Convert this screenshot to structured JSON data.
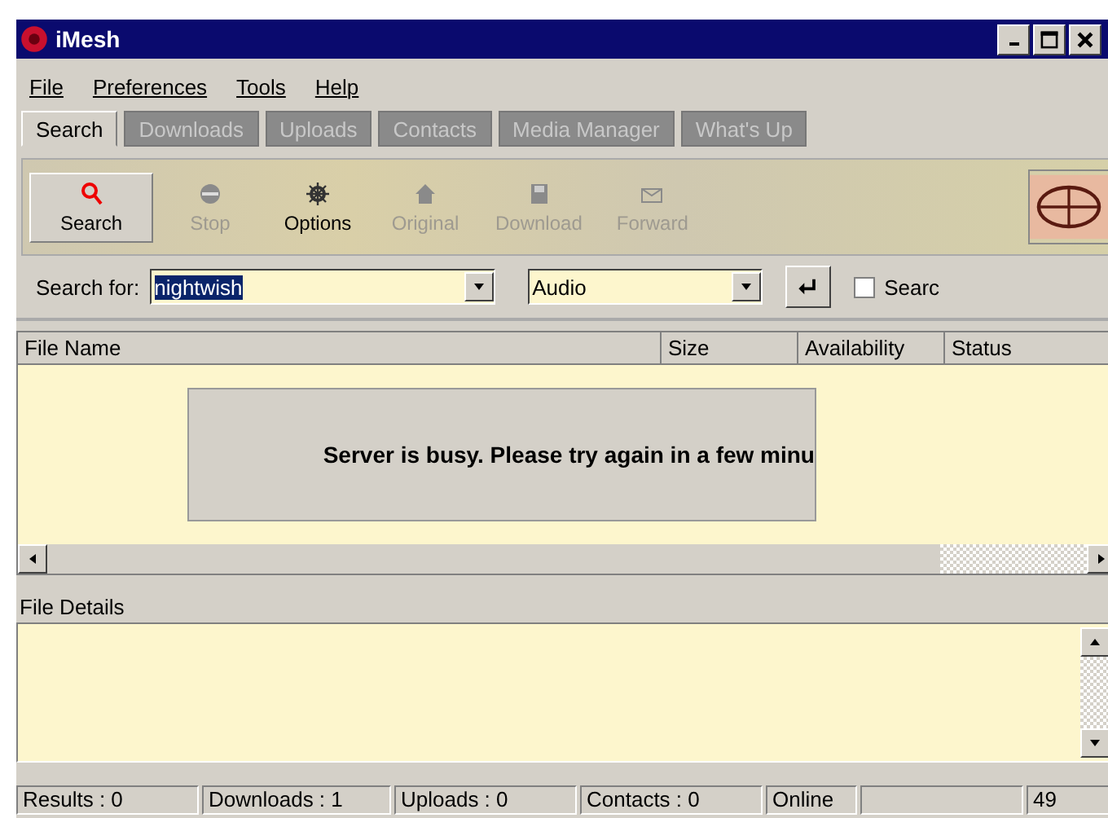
{
  "window": {
    "title": "iMesh"
  },
  "menu": [
    "File",
    "Preferences",
    "Tools",
    "Help"
  ],
  "tabs": [
    {
      "label": "Search",
      "selected": true
    },
    {
      "label": "Downloads",
      "selected": false
    },
    {
      "label": "Uploads",
      "selected": false
    },
    {
      "label": "Contacts",
      "selected": false
    },
    {
      "label": "Media Manager",
      "selected": false
    },
    {
      "label": "What's Up",
      "selected": false
    }
  ],
  "toolbar": [
    {
      "kind": "search",
      "label": "Search",
      "disabled": false
    },
    {
      "kind": "stop",
      "label": "Stop",
      "disabled": true
    },
    {
      "kind": "options",
      "label": "Options",
      "disabled": false
    },
    {
      "kind": "original",
      "label": "Original",
      "disabled": true
    },
    {
      "kind": "download",
      "label": "Download",
      "disabled": true
    },
    {
      "kind": "forward",
      "label": "Forward",
      "disabled": true
    }
  ],
  "search": {
    "label": "Search for:",
    "value": "nightwish",
    "type": "Audio",
    "checkbox_label": "Searc",
    "checked": false
  },
  "table": {
    "columns": [
      "File Name",
      "Size",
      "Availability",
      "Status"
    ]
  },
  "message": "Server is busy. Please try again in a few minu",
  "details": {
    "label": "File Details"
  },
  "status_bar": [
    "Results : 0",
    "Downloads : 1",
    "Uploads : 0",
    "Contacts : 0",
    "Online",
    "49"
  ]
}
